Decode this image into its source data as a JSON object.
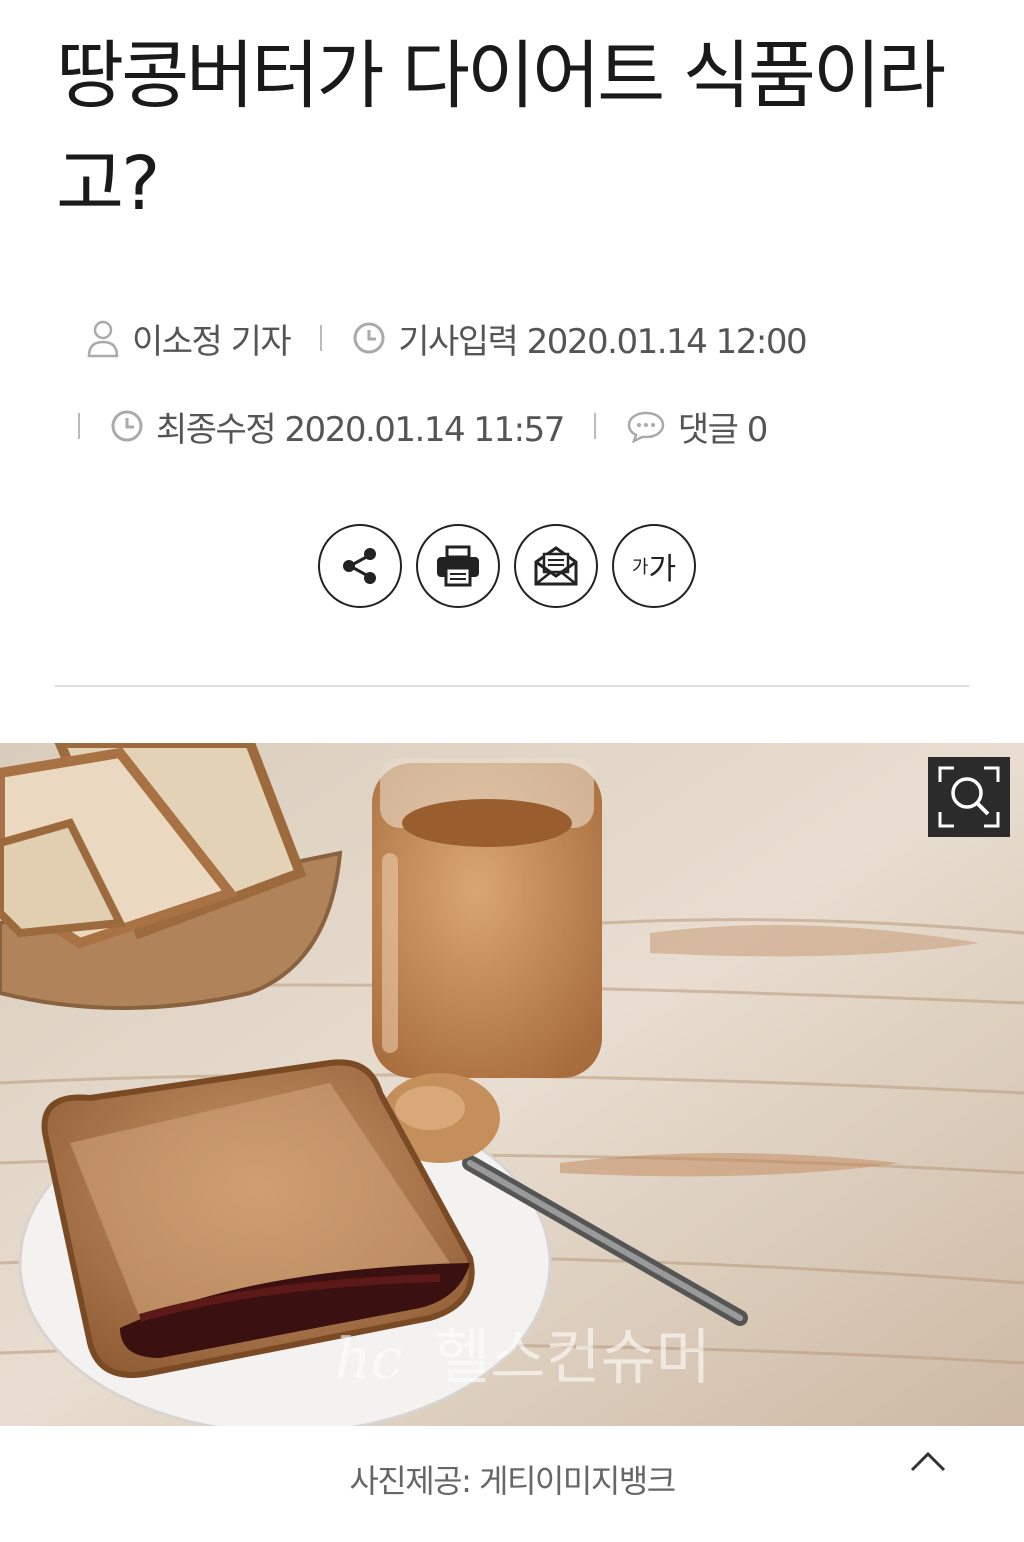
{
  "article": {
    "title": "땅콩버터가 다이어트 식품이라고?",
    "reporter": "이소정 기자",
    "published": "기사입력 2020.01.14 12:00",
    "modified": "최종수정 2020.01.14 11:57",
    "comments": "댓글 0"
  },
  "toolbar": {
    "share_icon": "share-icon",
    "print_icon": "print-icon",
    "email_icon": "email-icon",
    "font_small": "가",
    "font_large": "가"
  },
  "photo": {
    "watermark": "헬스컨슈머",
    "watermark_logo": "hc",
    "caption": "사진제공: 게티이미지뱅크"
  }
}
